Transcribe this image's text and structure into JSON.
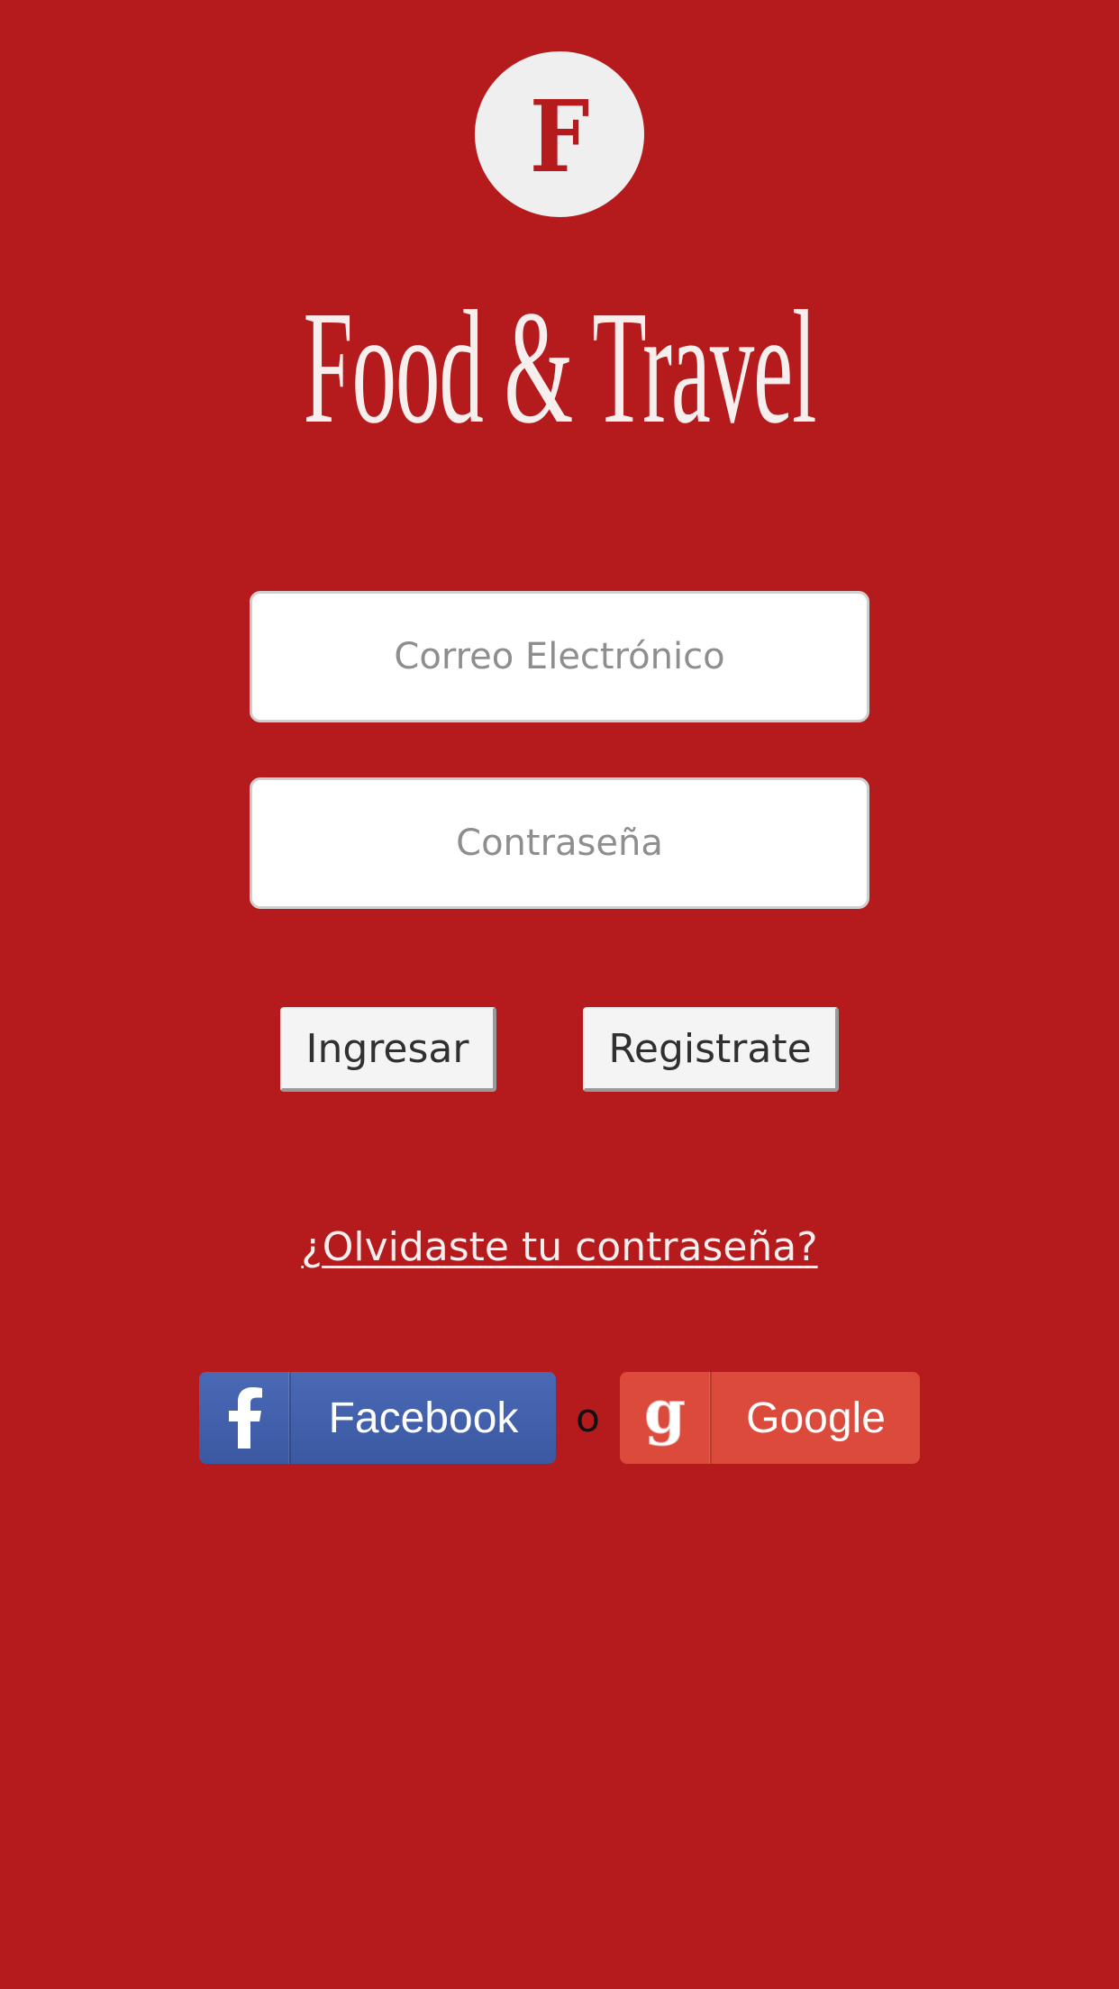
{
  "logo": {
    "letter": "F",
    "icon": "logo-f-icon"
  },
  "app": {
    "title": "Food & Travel"
  },
  "login_form": {
    "email_placeholder": "Correo Electrónico",
    "email_value": "",
    "password_placeholder": "Contraseña",
    "password_value": ""
  },
  "actions": {
    "login_label": "Ingresar",
    "register_label": "Registrate",
    "forgot_password_label": "¿Olvidaste tu contraseña?"
  },
  "social": {
    "facebook_label": "Facebook",
    "facebook_icon": "facebook-icon",
    "or_label": "o",
    "google_label": "Google",
    "google_icon": "google-icon"
  },
  "colors": {
    "background": "#b51b1c",
    "facebook": "#3b58a2",
    "google": "#dc4a3c"
  }
}
